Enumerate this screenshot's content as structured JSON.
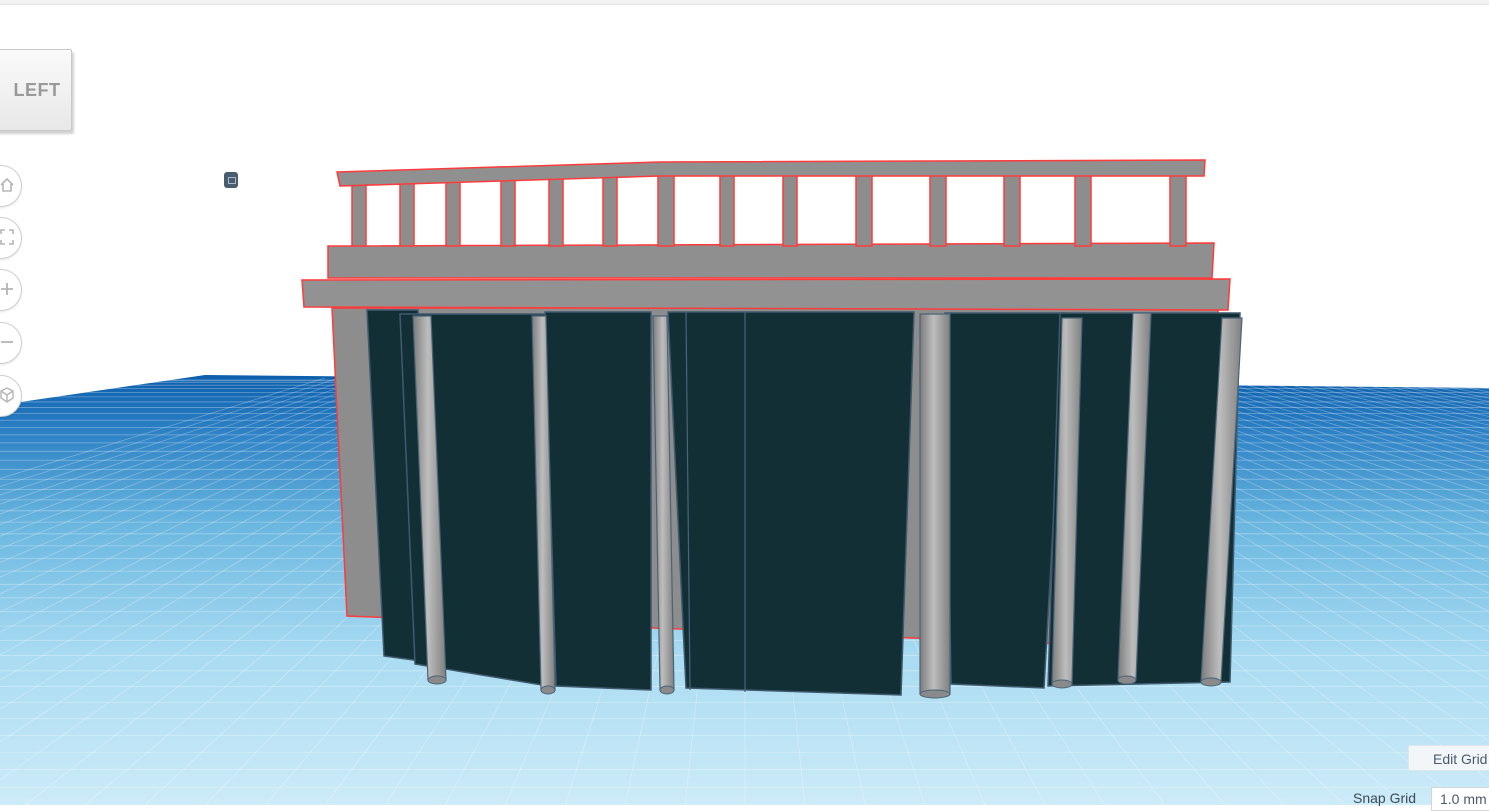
{
  "app": {
    "view": "3D workplane"
  },
  "view_cube": {
    "face_label": "LEFT"
  },
  "camera_controls": [
    {
      "name": "home-view",
      "icon": "home-icon"
    },
    {
      "name": "fit-view",
      "icon": "fit-all-icon"
    },
    {
      "name": "zoom-in",
      "icon": "plus-icon"
    },
    {
      "name": "zoom-out",
      "icon": "minus-icon"
    },
    {
      "name": "perspective",
      "icon": "cube-icon"
    }
  ],
  "grid": {
    "edit_label": "Edit Grid",
    "snap_label": "Snap Grid",
    "snap_value": "1.0 mm"
  },
  "colors": {
    "workplane_far": "#0a5cab",
    "workplane_near": "#c4e8f7",
    "model_grey": "#8f8f8f",
    "panel_dark": "#132e35",
    "selection_outline": "#ff3b3b"
  }
}
